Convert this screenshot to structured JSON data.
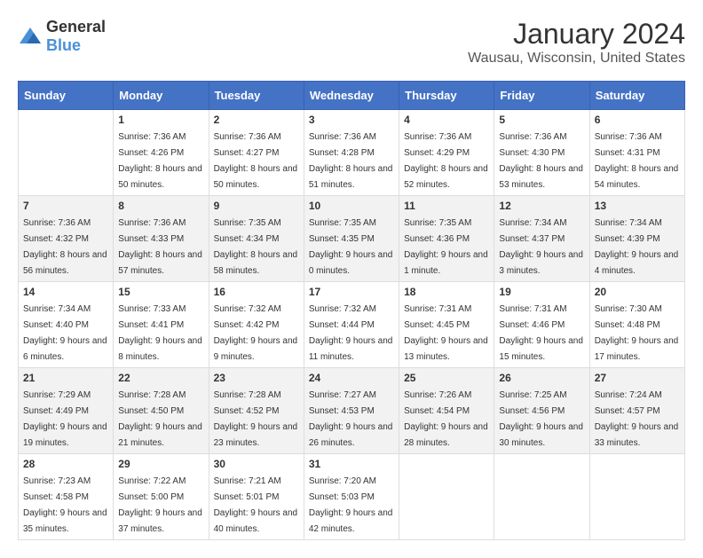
{
  "logo": {
    "general": "General",
    "blue": "Blue"
  },
  "title": "January 2024",
  "location": "Wausau, Wisconsin, United States",
  "headers": [
    "Sunday",
    "Monday",
    "Tuesday",
    "Wednesday",
    "Thursday",
    "Friday",
    "Saturday"
  ],
  "weeks": [
    [
      {
        "day": "",
        "sunrise": "",
        "sunset": "",
        "daylight": ""
      },
      {
        "day": "1",
        "sunrise": "Sunrise: 7:36 AM",
        "sunset": "Sunset: 4:26 PM",
        "daylight": "Daylight: 8 hours and 50 minutes."
      },
      {
        "day": "2",
        "sunrise": "Sunrise: 7:36 AM",
        "sunset": "Sunset: 4:27 PM",
        "daylight": "Daylight: 8 hours and 50 minutes."
      },
      {
        "day": "3",
        "sunrise": "Sunrise: 7:36 AM",
        "sunset": "Sunset: 4:28 PM",
        "daylight": "Daylight: 8 hours and 51 minutes."
      },
      {
        "day": "4",
        "sunrise": "Sunrise: 7:36 AM",
        "sunset": "Sunset: 4:29 PM",
        "daylight": "Daylight: 8 hours and 52 minutes."
      },
      {
        "day": "5",
        "sunrise": "Sunrise: 7:36 AM",
        "sunset": "Sunset: 4:30 PM",
        "daylight": "Daylight: 8 hours and 53 minutes."
      },
      {
        "day": "6",
        "sunrise": "Sunrise: 7:36 AM",
        "sunset": "Sunset: 4:31 PM",
        "daylight": "Daylight: 8 hours and 54 minutes."
      }
    ],
    [
      {
        "day": "7",
        "sunrise": "Sunrise: 7:36 AM",
        "sunset": "Sunset: 4:32 PM",
        "daylight": "Daylight: 8 hours and 56 minutes."
      },
      {
        "day": "8",
        "sunrise": "Sunrise: 7:36 AM",
        "sunset": "Sunset: 4:33 PM",
        "daylight": "Daylight: 8 hours and 57 minutes."
      },
      {
        "day": "9",
        "sunrise": "Sunrise: 7:35 AM",
        "sunset": "Sunset: 4:34 PM",
        "daylight": "Daylight: 8 hours and 58 minutes."
      },
      {
        "day": "10",
        "sunrise": "Sunrise: 7:35 AM",
        "sunset": "Sunset: 4:35 PM",
        "daylight": "Daylight: 9 hours and 0 minutes."
      },
      {
        "day": "11",
        "sunrise": "Sunrise: 7:35 AM",
        "sunset": "Sunset: 4:36 PM",
        "daylight": "Daylight: 9 hours and 1 minute."
      },
      {
        "day": "12",
        "sunrise": "Sunrise: 7:34 AM",
        "sunset": "Sunset: 4:37 PM",
        "daylight": "Daylight: 9 hours and 3 minutes."
      },
      {
        "day": "13",
        "sunrise": "Sunrise: 7:34 AM",
        "sunset": "Sunset: 4:39 PM",
        "daylight": "Daylight: 9 hours and 4 minutes."
      }
    ],
    [
      {
        "day": "14",
        "sunrise": "Sunrise: 7:34 AM",
        "sunset": "Sunset: 4:40 PM",
        "daylight": "Daylight: 9 hours and 6 minutes."
      },
      {
        "day": "15",
        "sunrise": "Sunrise: 7:33 AM",
        "sunset": "Sunset: 4:41 PM",
        "daylight": "Daylight: 9 hours and 8 minutes."
      },
      {
        "day": "16",
        "sunrise": "Sunrise: 7:32 AM",
        "sunset": "Sunset: 4:42 PM",
        "daylight": "Daylight: 9 hours and 9 minutes."
      },
      {
        "day": "17",
        "sunrise": "Sunrise: 7:32 AM",
        "sunset": "Sunset: 4:44 PM",
        "daylight": "Daylight: 9 hours and 11 minutes."
      },
      {
        "day": "18",
        "sunrise": "Sunrise: 7:31 AM",
        "sunset": "Sunset: 4:45 PM",
        "daylight": "Daylight: 9 hours and 13 minutes."
      },
      {
        "day": "19",
        "sunrise": "Sunrise: 7:31 AM",
        "sunset": "Sunset: 4:46 PM",
        "daylight": "Daylight: 9 hours and 15 minutes."
      },
      {
        "day": "20",
        "sunrise": "Sunrise: 7:30 AM",
        "sunset": "Sunset: 4:48 PM",
        "daylight": "Daylight: 9 hours and 17 minutes."
      }
    ],
    [
      {
        "day": "21",
        "sunrise": "Sunrise: 7:29 AM",
        "sunset": "Sunset: 4:49 PM",
        "daylight": "Daylight: 9 hours and 19 minutes."
      },
      {
        "day": "22",
        "sunrise": "Sunrise: 7:28 AM",
        "sunset": "Sunset: 4:50 PM",
        "daylight": "Daylight: 9 hours and 21 minutes."
      },
      {
        "day": "23",
        "sunrise": "Sunrise: 7:28 AM",
        "sunset": "Sunset: 4:52 PM",
        "daylight": "Daylight: 9 hours and 23 minutes."
      },
      {
        "day": "24",
        "sunrise": "Sunrise: 7:27 AM",
        "sunset": "Sunset: 4:53 PM",
        "daylight": "Daylight: 9 hours and 26 minutes."
      },
      {
        "day": "25",
        "sunrise": "Sunrise: 7:26 AM",
        "sunset": "Sunset: 4:54 PM",
        "daylight": "Daylight: 9 hours and 28 minutes."
      },
      {
        "day": "26",
        "sunrise": "Sunrise: 7:25 AM",
        "sunset": "Sunset: 4:56 PM",
        "daylight": "Daylight: 9 hours and 30 minutes."
      },
      {
        "day": "27",
        "sunrise": "Sunrise: 7:24 AM",
        "sunset": "Sunset: 4:57 PM",
        "daylight": "Daylight: 9 hours and 33 minutes."
      }
    ],
    [
      {
        "day": "28",
        "sunrise": "Sunrise: 7:23 AM",
        "sunset": "Sunset: 4:58 PM",
        "daylight": "Daylight: 9 hours and 35 minutes."
      },
      {
        "day": "29",
        "sunrise": "Sunrise: 7:22 AM",
        "sunset": "Sunset: 5:00 PM",
        "daylight": "Daylight: 9 hours and 37 minutes."
      },
      {
        "day": "30",
        "sunrise": "Sunrise: 7:21 AM",
        "sunset": "Sunset: 5:01 PM",
        "daylight": "Daylight: 9 hours and 40 minutes."
      },
      {
        "day": "31",
        "sunrise": "Sunrise: 7:20 AM",
        "sunset": "Sunset: 5:03 PM",
        "daylight": "Daylight: 9 hours and 42 minutes."
      },
      {
        "day": "",
        "sunrise": "",
        "sunset": "",
        "daylight": ""
      },
      {
        "day": "",
        "sunrise": "",
        "sunset": "",
        "daylight": ""
      },
      {
        "day": "",
        "sunrise": "",
        "sunset": "",
        "daylight": ""
      }
    ]
  ]
}
